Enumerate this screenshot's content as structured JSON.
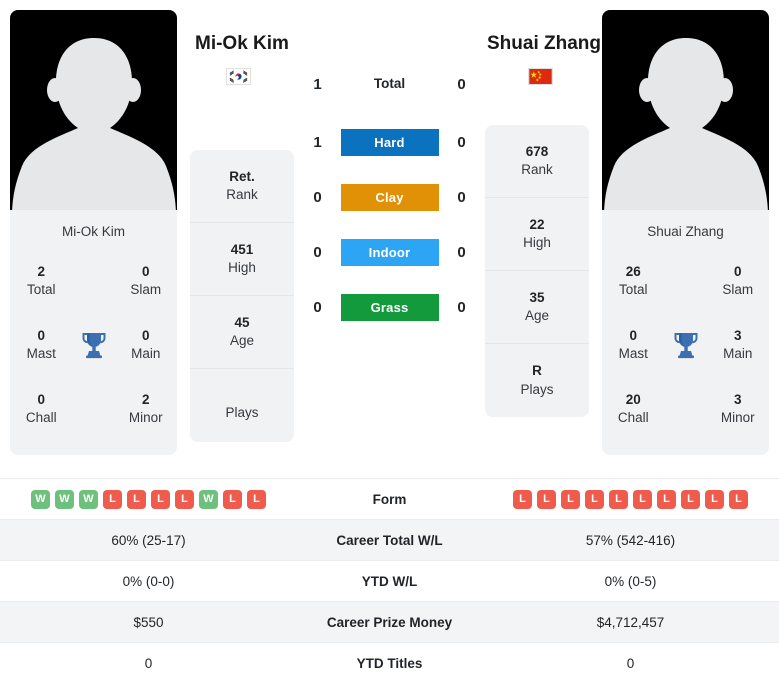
{
  "players": {
    "left": {
      "name": "Mi-Ok Kim",
      "flag": "kr-flag-icon",
      "card_name": "Mi-Ok Kim",
      "rank": {
        "value": "Ret.",
        "label": "Rank"
      },
      "high": {
        "value": "451",
        "label": "High"
      },
      "age": {
        "value": "45",
        "label": "Age"
      },
      "plays": {
        "value": "",
        "label": "Plays"
      },
      "titles": [
        {
          "value": "2",
          "label": "Total"
        },
        {
          "value": "0",
          "label": "Slam"
        },
        {
          "value": "0",
          "label": "Mast"
        },
        {
          "value": "0",
          "label": "Main"
        },
        {
          "value": "0",
          "label": "Chall"
        },
        {
          "value": "2",
          "label": "Minor"
        }
      ],
      "form": [
        "W",
        "W",
        "W",
        "L",
        "L",
        "L",
        "L",
        "W",
        "L",
        "L"
      ],
      "career_total_wl": "60% (25-17)",
      "ytd_wl": "0% (0-0)",
      "career_prize_money": "$550",
      "ytd_titles": "0"
    },
    "right": {
      "name": "Shuai Zhang",
      "flag": "cn-flag-icon",
      "card_name": "Shuai Zhang",
      "rank": {
        "value": "678",
        "label": "Rank"
      },
      "high": {
        "value": "22",
        "label": "High"
      },
      "age": {
        "value": "35",
        "label": "Age"
      },
      "plays": {
        "value": "R",
        "label": "Plays"
      },
      "titles": [
        {
          "value": "26",
          "label": "Total"
        },
        {
          "value": "0",
          "label": "Slam"
        },
        {
          "value": "0",
          "label": "Mast"
        },
        {
          "value": "3",
          "label": "Main"
        },
        {
          "value": "20",
          "label": "Chall"
        },
        {
          "value": "3",
          "label": "Minor"
        }
      ],
      "form": [
        "L",
        "L",
        "L",
        "L",
        "L",
        "L",
        "L",
        "L",
        "L",
        "L"
      ],
      "career_total_wl": "57% (542-416)",
      "ytd_wl": "0% (0-5)",
      "career_prize_money": "$4,712,457",
      "ytd_titles": "0"
    }
  },
  "h2h": {
    "total": {
      "label": "Total",
      "left": "1",
      "right": "0"
    },
    "surfaces": [
      {
        "label": "Hard",
        "left": "1",
        "right": "0",
        "color": "#0b72bf"
      },
      {
        "label": "Clay",
        "left": "0",
        "right": "0",
        "color": "#e09106"
      },
      {
        "label": "Indoor",
        "left": "0",
        "right": "0",
        "color": "#2da5f5"
      },
      {
        "label": "Grass",
        "left": "0",
        "right": "0",
        "color": "#139a3d"
      }
    ]
  },
  "stats_table": {
    "rows": [
      {
        "label": "Form",
        "left": "",
        "right": ""
      },
      {
        "label": "Career Total W/L",
        "left": "60% (25-17)",
        "right": "57% (542-416)"
      },
      {
        "label": "YTD W/L",
        "left": "0% (0-0)",
        "right": "0% (0-5)"
      },
      {
        "label": "Career Prize Money",
        "left": "$550",
        "right": "$4,712,457"
      },
      {
        "label": "YTD Titles",
        "left": "0",
        "right": "0"
      }
    ]
  },
  "colors": {
    "hard": "#0b72bf",
    "clay": "#e09106",
    "indoor": "#2da5f5",
    "grass": "#139a3d",
    "win": "#6ec17d",
    "loss": "#ef5b4c",
    "trophy": "#3b6fb0",
    "card_bg": "#f1f2f3"
  }
}
